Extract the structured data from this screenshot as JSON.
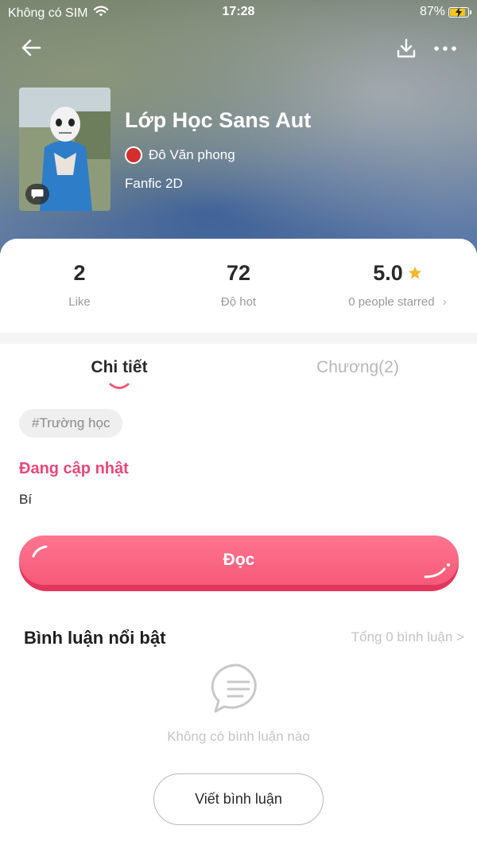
{
  "status_bar": {
    "carrier": "Không có SIM",
    "time": "17:28",
    "battery": "87%",
    "icons": [
      "wifi-icon",
      "battery-charging-icon"
    ]
  },
  "nav": {
    "icons": [
      "arrow-back-icon",
      "download-icon",
      "more-icon"
    ]
  },
  "story": {
    "title": "Lớp Học Sans Aut",
    "author": "Đô Văn phong",
    "category": "Fanfic 2D",
    "cover_badge_icon": "comment-bubble-icon"
  },
  "stats": {
    "likes": {
      "value": "2",
      "label": "Like"
    },
    "hot": {
      "value": "72",
      "label": "Độ hot"
    },
    "rating": {
      "value": "5.0",
      "label": "0 people starred",
      "chevron": "›"
    }
  },
  "tabs": {
    "details": "Chi tiết",
    "chapters": "Chương(2)"
  },
  "tag": "#Trường học",
  "status": "Đang cập nhật",
  "description": "Bí",
  "read_button": "Đọc",
  "comments": {
    "title": "Bình luận nổi bật",
    "total": "Tổng 0 bình luận >",
    "empty": "Không có bình luận nào",
    "write_button": "Viết bình luận"
  },
  "colors": {
    "accent": "#f65a78",
    "accent_dark": "#e3365c",
    "status_pink": "#e8487a",
    "star": "#f5b82e"
  }
}
